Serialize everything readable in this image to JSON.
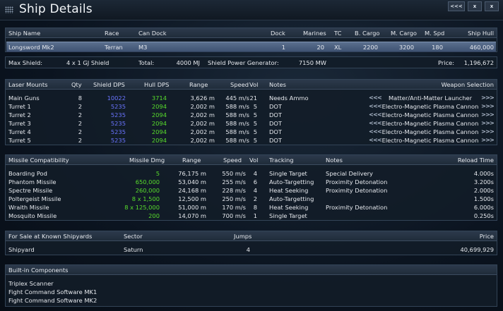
{
  "window": {
    "title": "Ship Details",
    "buttons": [
      "<<<",
      "x",
      "x"
    ]
  },
  "ship": {
    "headers": {
      "name": "Ship Name",
      "race": "Race",
      "can_dock": "Can Dock",
      "dock": "Dock",
      "marines": "Marines",
      "tc": "TC",
      "b_cargo": "B. Cargo",
      "m_cargo": "M. Cargo",
      "m_spd": "M. Spd",
      "hull": "Ship Hull"
    },
    "name": "Longsword Mk2",
    "race": "Terran",
    "can_dock": "M3",
    "dock": "1",
    "marines": "20",
    "tc": "XL",
    "b_cargo": "2200",
    "m_cargo": "3200",
    "m_spd": "180",
    "hull": "460,000"
  },
  "shield": {
    "max_label": "Max Shield:",
    "max_value": "4 x 1 GJ Shield",
    "total_label": "Total:",
    "total_value": "4000 MJ",
    "gen_label": "Shield Power Generator:",
    "gen_value": "7150 MW",
    "price_label": "Price:",
    "price_value": "1,196,672"
  },
  "lasers": {
    "headers": {
      "mounts": "Laser Mounts",
      "qty": "Qty",
      "sdps": "Shield DPS",
      "hdps": "Hull DPS",
      "range": "Range",
      "speed": "Speed",
      "vol": "Vol",
      "notes": "Notes",
      "selection": "Weapon Selection"
    },
    "rows": [
      {
        "mount": "Main Guns",
        "qty": "8",
        "sdps": "10022",
        "hdps": "3714",
        "range": "3,626 m",
        "speed": "445 m/s",
        "vol": "21",
        "notes": "Needs Ammo",
        "weapon": "Matter/Anti-Matter Launcher"
      },
      {
        "mount": "Turret 1",
        "qty": "2",
        "sdps": "5235",
        "hdps": "2094",
        "range": "2,002 m",
        "speed": "588 m/s",
        "vol": "5",
        "notes": "DOT",
        "weapon": "Electro-Magnetic Plasma Cannon"
      },
      {
        "mount": "Turret 2",
        "qty": "2",
        "sdps": "5235",
        "hdps": "2094",
        "range": "2,002 m",
        "speed": "588 m/s",
        "vol": "5",
        "notes": "DOT",
        "weapon": "Electro-Magnetic Plasma Cannon"
      },
      {
        "mount": "Turret 3",
        "qty": "2",
        "sdps": "5235",
        "hdps": "2094",
        "range": "2,002 m",
        "speed": "588 m/s",
        "vol": "5",
        "notes": "DOT",
        "weapon": "Electro-Magnetic Plasma Cannon"
      },
      {
        "mount": "Turret 4",
        "qty": "2",
        "sdps": "5235",
        "hdps": "2094",
        "range": "2,002 m",
        "speed": "588 m/s",
        "vol": "5",
        "notes": "DOT",
        "weapon": "Electro-Magnetic Plasma Cannon"
      },
      {
        "mount": "Turret 5",
        "qty": "2",
        "sdps": "5235",
        "hdps": "2094",
        "range": "2,002 m",
        "speed": "588 m/s",
        "vol": "5",
        "notes": "DOT",
        "weapon": "Electro-Magnetic Plasma Cannon"
      }
    ],
    "prev_arrow": "<<<",
    "next_arrow": ">>>"
  },
  "missiles": {
    "headers": {
      "compat": "Missile Compatibility",
      "dmg": "Missile Dmg",
      "range": "Range",
      "speed": "Speed",
      "vol": "Vol",
      "tracking": "Tracking",
      "notes": "Notes",
      "reload": "Reload Time"
    },
    "rows": [
      {
        "name": "Boarding Pod",
        "dmg": "5",
        "range": "76,175 m",
        "speed": "550 m/s",
        "vol": "4",
        "tracking": "Single Target",
        "notes": "Special Delivery",
        "reload": "4.000s"
      },
      {
        "name": "Phantom Missile",
        "dmg": "650,000",
        "range": "53,040 m",
        "speed": "255 m/s",
        "vol": "6",
        "tracking": "Auto-Targetting",
        "notes": "Proximity Detonation",
        "reload": "3.200s"
      },
      {
        "name": "Spectre Missile",
        "dmg": "260,000",
        "range": "24,168 m",
        "speed": "228 m/s",
        "vol": "4",
        "tracking": "Heat Seeking",
        "notes": "Proximity Detonation",
        "reload": "2.000s"
      },
      {
        "name": "Poltergeist Missile",
        "dmg": "8 x 1,500",
        "range": "12,500 m",
        "speed": "250 m/s",
        "vol": "2",
        "tracking": "Auto-Targetting",
        "notes": "",
        "reload": "1.500s"
      },
      {
        "name": "Wraith Missile",
        "dmg": "8 x 125,000",
        "range": "51,000 m",
        "speed": "170 m/s",
        "vol": "8",
        "tracking": "Heat Seeking",
        "notes": "Proximity Detonation",
        "reload": "6.000s"
      },
      {
        "name": "Mosquito Missile",
        "dmg": "200",
        "range": "14,070 m",
        "speed": "700 m/s",
        "vol": "1",
        "tracking": "Single Target",
        "notes": "",
        "reload": "0.250s"
      }
    ]
  },
  "sale": {
    "headers": {
      "label": "For Sale at Known Shipyards",
      "sector": "Sector",
      "jumps": "Jumps",
      "price": "Price"
    },
    "row": {
      "name": "Shipyard",
      "sector": "Saturn",
      "jumps": "4",
      "price": "40,699,929"
    }
  },
  "components": {
    "header": "Built-in Components",
    "items": [
      "Triplex Scanner",
      "Fight Command Software MK1",
      "Fight Command Software MK2"
    ]
  },
  "colors": {
    "shield_dps": "#6a74ff",
    "hull_dps": "#58dd2c",
    "missile_dmg": "#58dd2c",
    "selected_row": "#4d6284"
  }
}
